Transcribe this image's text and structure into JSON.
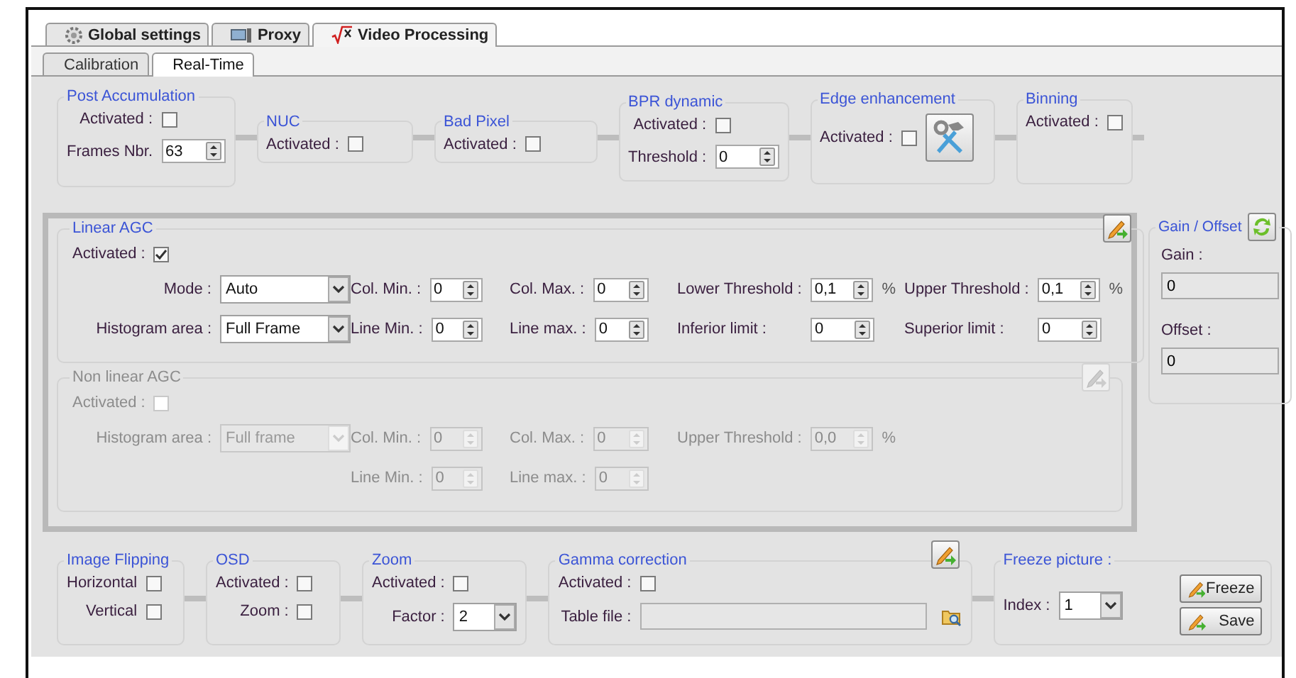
{
  "tabs": [
    {
      "label": "Global settings",
      "selected": false
    },
    {
      "label": "Proxy",
      "selected": false
    },
    {
      "label": "Video Processing",
      "selected": true
    }
  ],
  "subtabs": [
    {
      "label": "Calibration",
      "selected": false
    },
    {
      "label": "Real-Time",
      "selected": true
    }
  ],
  "pipeline": [
    {
      "title": "Post Accumulation",
      "fields": [
        {
          "kind": "checkbox",
          "label": "Activated :",
          "checked": false
        },
        {
          "kind": "spin",
          "label": "Frames Nbr.",
          "value": "63"
        }
      ]
    },
    {
      "title": "NUC",
      "fields": [
        {
          "kind": "checkbox",
          "label": "Activated :",
          "checked": false
        }
      ]
    },
    {
      "title": "Bad Pixel",
      "fields": [
        {
          "kind": "checkbox",
          "label": "Activated :",
          "checked": false
        }
      ]
    },
    {
      "title": "BPR dynamic",
      "fields": [
        {
          "kind": "checkbox",
          "label": "Activated :",
          "checked": false
        },
        {
          "kind": "spin",
          "label": "Threshold :",
          "value": "0"
        }
      ]
    },
    {
      "title": "Edge enhancement",
      "tool_button": true,
      "fields": [
        {
          "kind": "checkbox",
          "label": "Activated :",
          "checked": false
        }
      ]
    },
    {
      "title": "Binning",
      "fields": [
        {
          "kind": "checkbox",
          "label": "Activated :",
          "checked": false
        }
      ]
    }
  ],
  "agc": [
    {
      "title": "Linear AGC",
      "disabled": false,
      "apply_button": true,
      "activated": {
        "label": "Activated :",
        "checked": true
      },
      "rows": [
        [
          {
            "kind": "select",
            "label": "Mode :",
            "value": "Auto"
          },
          {
            "kind": "spin",
            "label": "Col. Min. :",
            "value": "0"
          },
          {
            "kind": "spin",
            "label": "Col. Max. :",
            "value": "0"
          },
          {
            "kind": "spin",
            "label": "Lower Threshold :",
            "value": "0,1",
            "unit": "%"
          },
          {
            "kind": "spin",
            "label": "Upper Threshold :",
            "value": "0,1",
            "unit": "%"
          }
        ],
        [
          {
            "kind": "select",
            "label": "Histogram area :",
            "value": "Full Frame"
          },
          {
            "kind": "spin",
            "label": "Line Min. :",
            "value": "0"
          },
          {
            "kind": "spin",
            "label": "Line max. :",
            "value": "0"
          },
          {
            "kind": "spin",
            "label": "Inferior limit :",
            "value": "0"
          },
          {
            "kind": "spin",
            "label": "Superior limit :",
            "value": "0"
          }
        ]
      ]
    },
    {
      "title": "Non linear AGC",
      "disabled": true,
      "apply_button": true,
      "activated": {
        "label": "Activated :",
        "checked": false
      },
      "rows": [
        [
          {
            "kind": "select",
            "label": "Histogram area :",
            "value": "Full frame"
          },
          {
            "kind": "spin",
            "label": "Col. Min. :",
            "value": "0"
          },
          {
            "kind": "spin",
            "label": "Col. Max. :",
            "value": "0"
          },
          {
            "kind": "spin",
            "label": "Upper Threshold :",
            "value": "0,0",
            "unit": "%"
          }
        ],
        [
          {
            "kind": "empty"
          },
          {
            "kind": "spin",
            "label": "Line Min. :",
            "value": "0"
          },
          {
            "kind": "spin",
            "label": "Line max. :",
            "value": "0"
          }
        ]
      ]
    }
  ],
  "gain_offset": {
    "title": "Gain / Offset",
    "fields": [
      {
        "label": "Gain :",
        "value": "0"
      },
      {
        "label": "Offset :",
        "value": "0"
      }
    ]
  },
  "bottom": [
    {
      "title": "Image Flipping",
      "fields": [
        {
          "kind": "checkbox",
          "label": "Horizontal",
          "checked": false
        },
        {
          "kind": "checkbox",
          "label": "Vertical",
          "checked": false
        }
      ]
    },
    {
      "title": "OSD",
      "fields": [
        {
          "kind": "checkbox",
          "label": "Activated :",
          "checked": false
        },
        {
          "kind": "checkbox",
          "label": "Zoom :",
          "checked": false
        }
      ]
    },
    {
      "title": "Zoom",
      "fields": [
        {
          "kind": "checkbox",
          "label": "Activated :",
          "checked": false
        },
        {
          "kind": "select",
          "label": "Factor :",
          "value": "2"
        }
      ]
    },
    {
      "title": "Gamma correction",
      "apply_button": true,
      "fields": [
        {
          "kind": "checkbox",
          "label": "Activated :",
          "checked": false
        },
        {
          "kind": "file",
          "label": "Table file :"
        }
      ]
    },
    {
      "title": "Freeze picture :",
      "fields": [
        {
          "kind": "select",
          "label": "Index :",
          "value": "1"
        }
      ],
      "buttons": [
        "Freeze",
        "Save"
      ]
    }
  ]
}
